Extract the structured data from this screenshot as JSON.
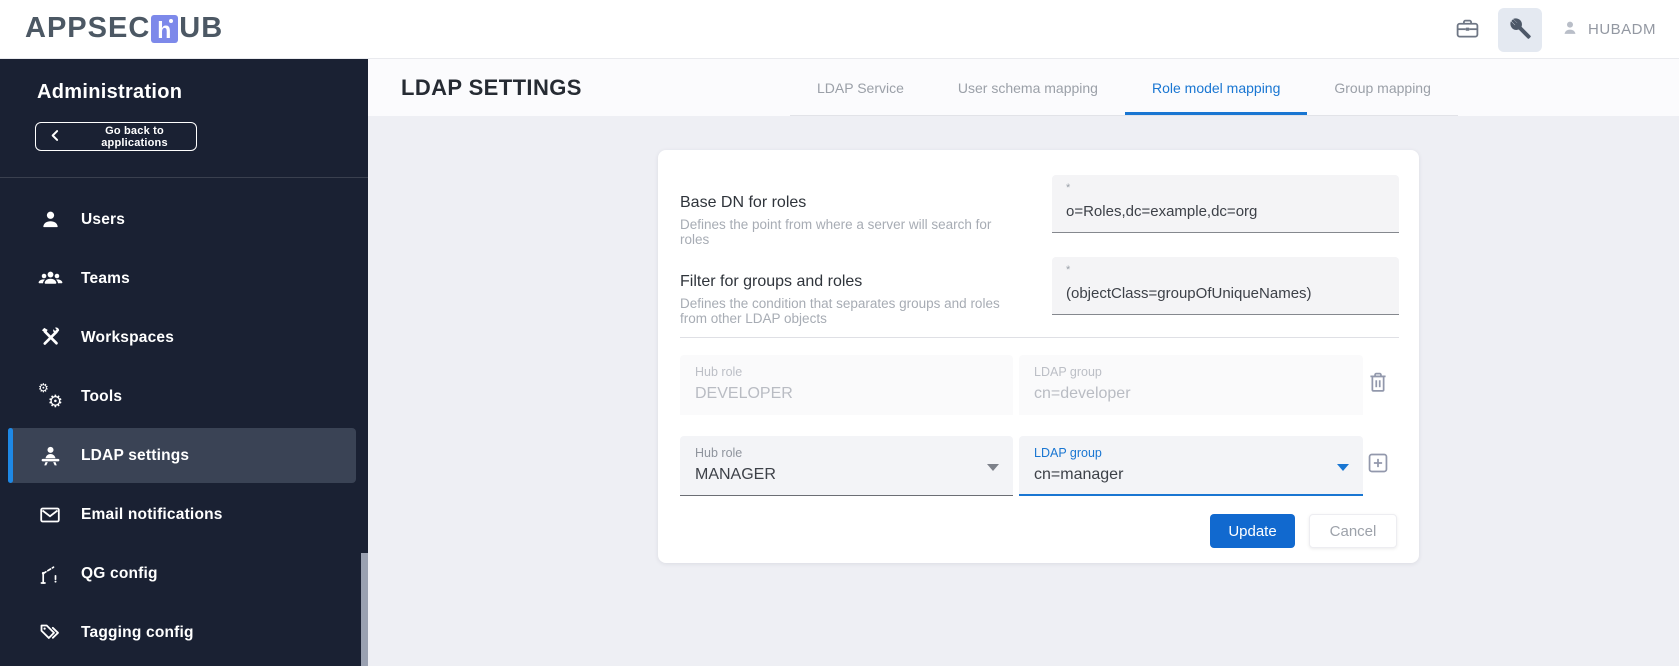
{
  "topbar": {
    "logo": {
      "prefix": "APPSEC",
      "hub_letter": "h",
      "suffix": "UB"
    },
    "applications_icon": "briefcase-icon",
    "admin_icon": "tools-icon",
    "user_label": "HUBADM"
  },
  "sidebar": {
    "title": "Administration",
    "back_button_label": "Go back to applications",
    "items": [
      {
        "label": "Users",
        "icon": "user-icon",
        "selected": false
      },
      {
        "label": "Teams",
        "icon": "teams-icon",
        "selected": false
      },
      {
        "label": "Workspaces",
        "icon": "workspaces-icon",
        "selected": false
      },
      {
        "label": "Tools",
        "icon": "gears-icon",
        "selected": false
      },
      {
        "label": "LDAP settings",
        "icon": "ldap-icon",
        "selected": true
      },
      {
        "label": "Email notifications",
        "icon": "email-icon",
        "selected": false
      },
      {
        "label": "QG config",
        "icon": "quality-gate-icon",
        "selected": false
      },
      {
        "label": "Tagging config",
        "icon": "tag-icon",
        "selected": false
      }
    ]
  },
  "header": {
    "title": "LDAP SETTINGS",
    "tabs": [
      {
        "label": "LDAP Service",
        "active": false
      },
      {
        "label": "User schema mapping",
        "active": false
      },
      {
        "label": "Role model mapping",
        "active": true
      },
      {
        "label": "Group mapping",
        "active": false
      }
    ]
  },
  "form": {
    "fields": [
      {
        "label": "Base DN for roles",
        "description": "Defines the point from where a server will search for roles",
        "required_marker": "*",
        "value": "o=Roles,dc=example,dc=org"
      },
      {
        "label": "Filter for groups and roles",
        "description": "Defines the condition that separates groups and roles from other LDAP objects",
        "required_marker": "*",
        "value": "(objectClass=groupOfUniqueNames)"
      }
    ],
    "role_mappings": [
      {
        "hub_role_label": "Hub role",
        "hub_role_value": "DEVELOPER",
        "ldap_group_label": "LDAP group",
        "ldap_group_value": "cn=developer",
        "disabled": true
      },
      {
        "hub_role_label": "Hub role",
        "hub_role_value": "MANAGER",
        "ldap_group_label": "LDAP group",
        "ldap_group_value": "cn=manager",
        "disabled": false
      }
    ],
    "update_label": "Update",
    "cancel_label": "Cancel"
  },
  "colors": {
    "accent": "#1976d2",
    "sidebar_bg": "#1a2133",
    "sidebar_selected_bg": "#3a4355",
    "selected_bar": "#1e88e5",
    "update_button_bg": "#1169cf",
    "content_bg": "#eeeff4",
    "logo_hub_bg": "#7d89ea"
  }
}
